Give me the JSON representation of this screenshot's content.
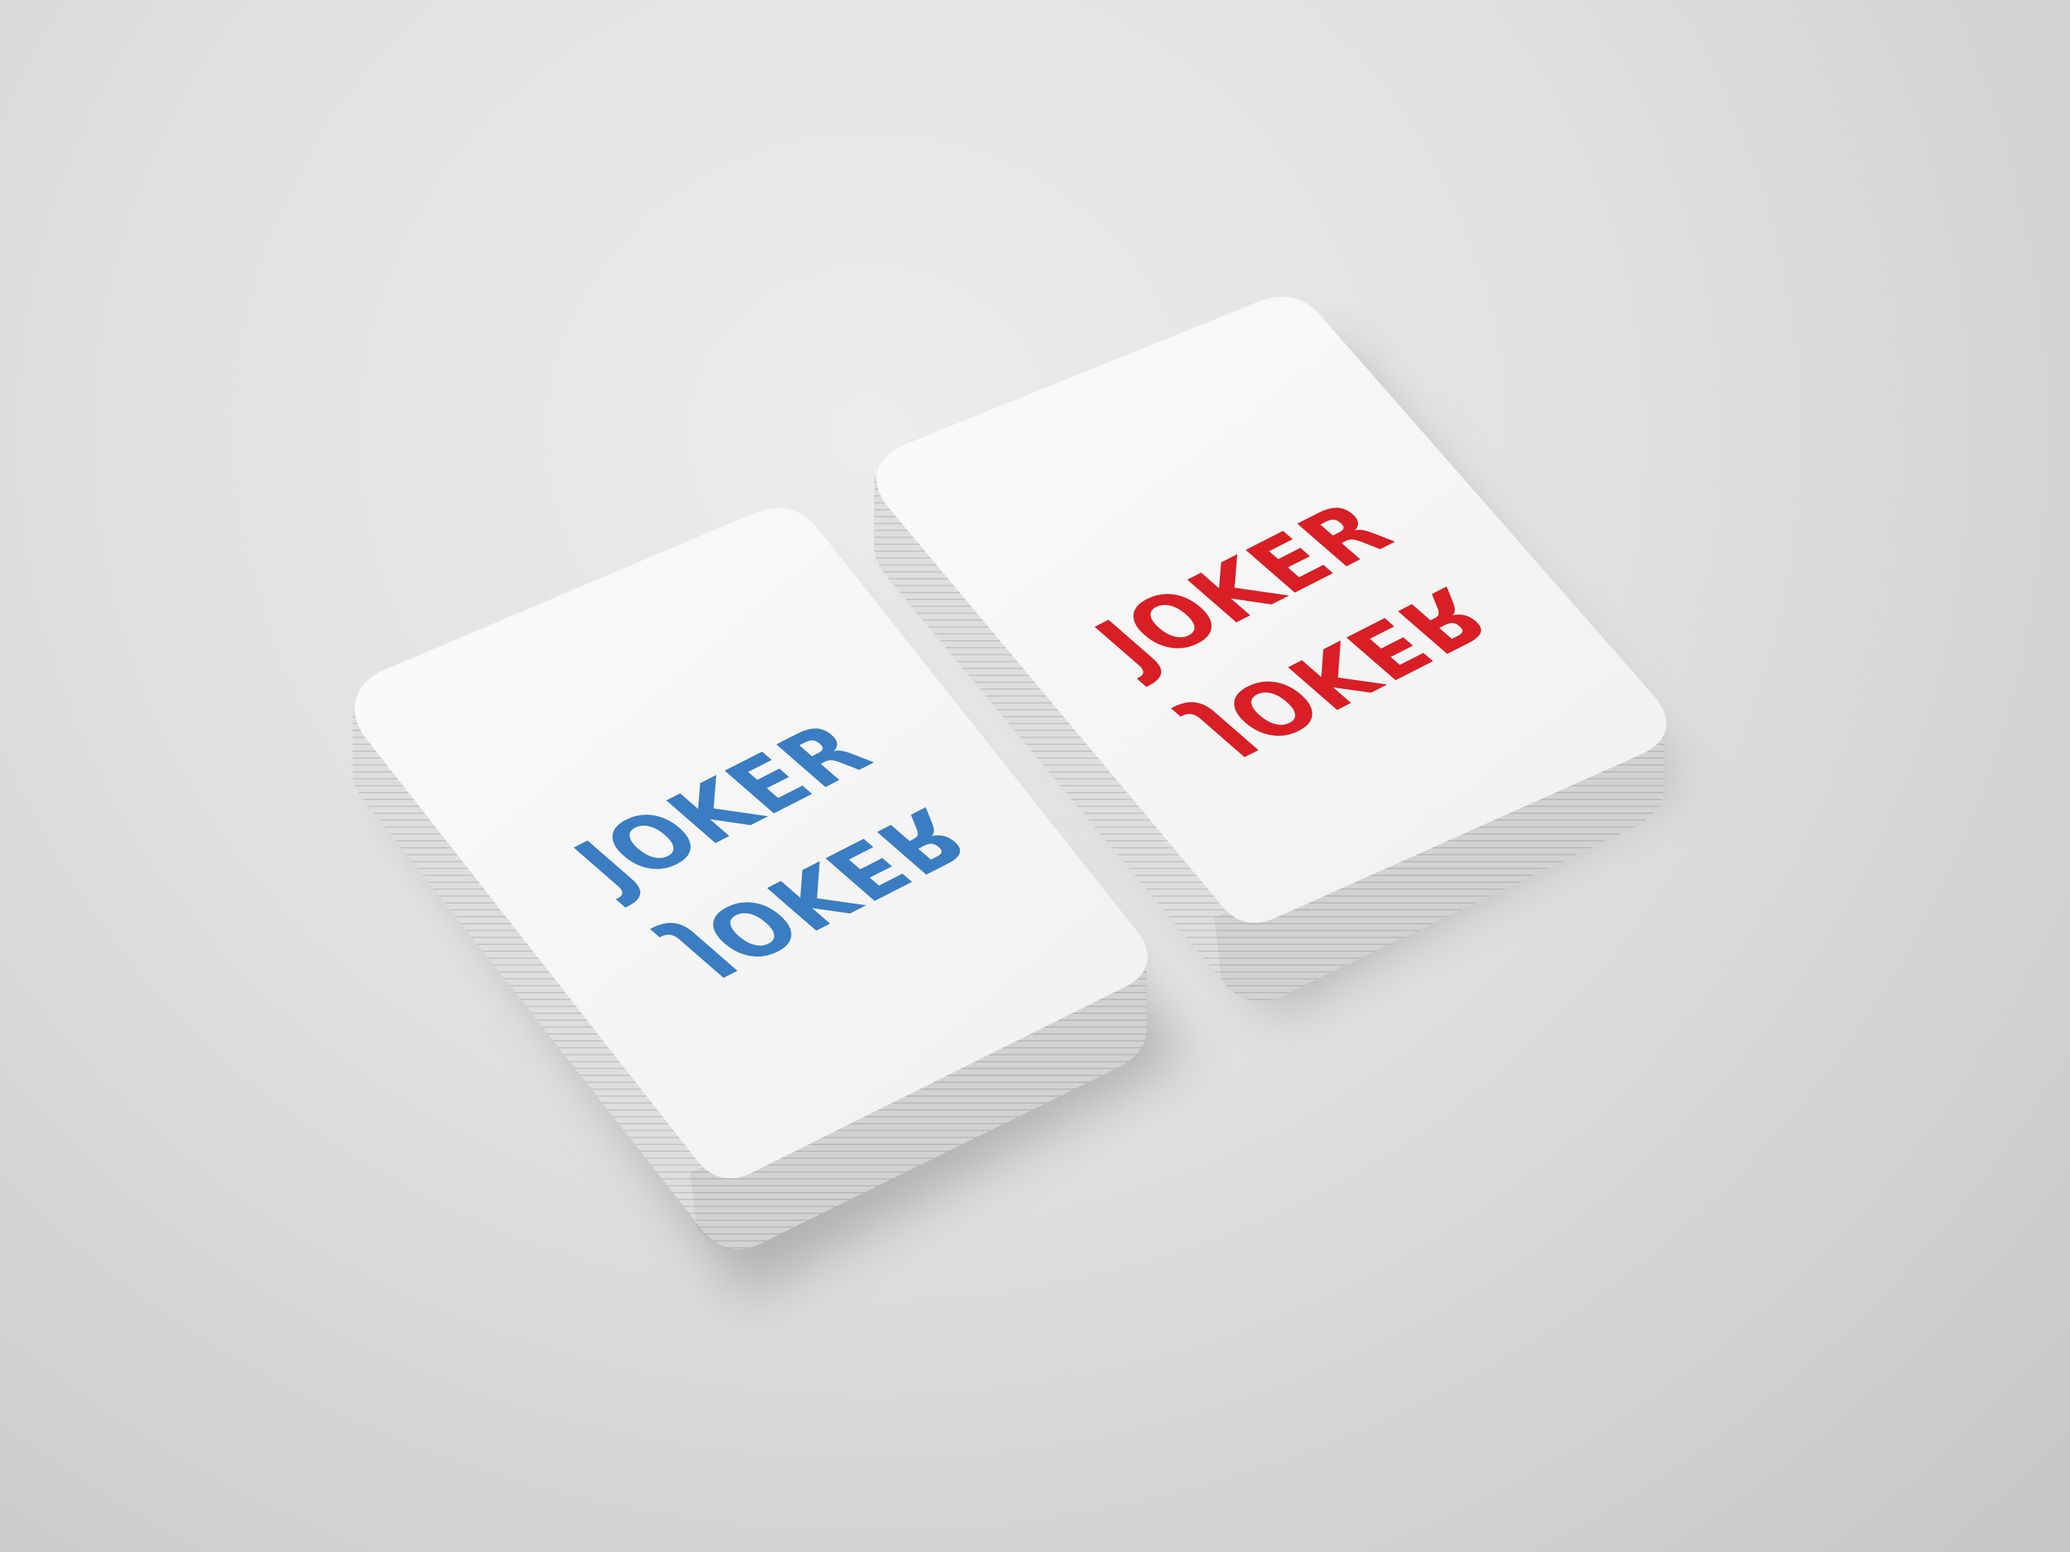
{
  "scene": {
    "description_tags": [
      "mockup",
      "playing-card-decks"
    ]
  },
  "decks": [
    {
      "name": "blue-deck",
      "logo_text": "JOKER",
      "accent_color": "#3a7dc3"
    },
    {
      "name": "red-deck",
      "logo_text": "JOKER",
      "accent_color": "#d91e25"
    }
  ],
  "colors": {
    "card_face": "#f7f7f7",
    "card_edge": "#dcdcdc",
    "shadow": "#9a9a9a",
    "background": "#dedede"
  }
}
